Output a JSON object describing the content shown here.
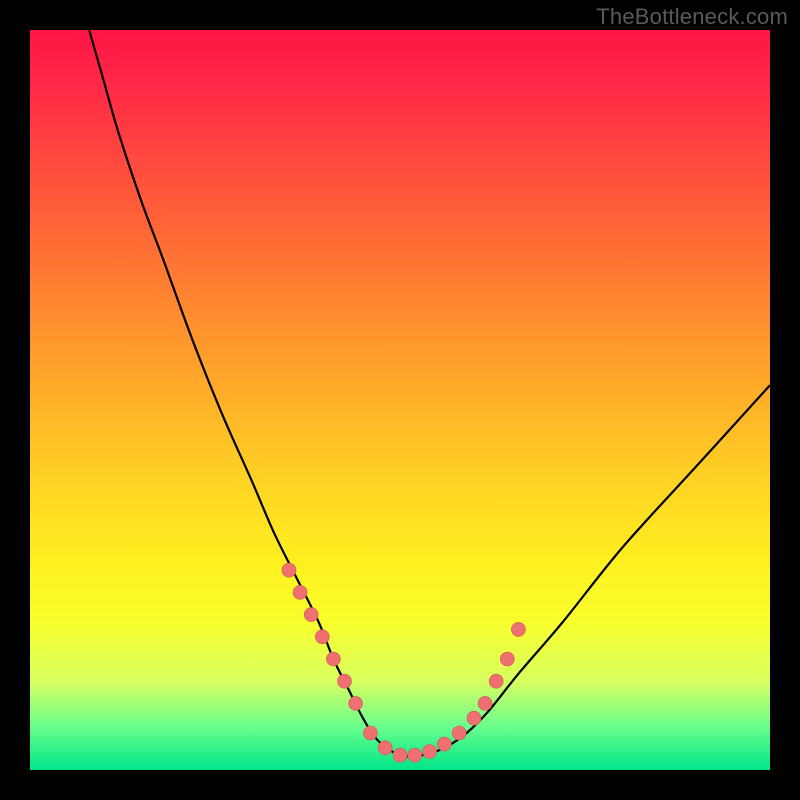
{
  "watermark": "TheBottleneck.com",
  "chart_data": {
    "type": "line",
    "title": "",
    "xlabel": "",
    "ylabel": "",
    "xlim": [
      0,
      100
    ],
    "ylim": [
      0,
      100
    ],
    "series": [
      {
        "name": "bottleneck-curve",
        "x": [
          8,
          10,
          12,
          15,
          18,
          22,
          26,
          30,
          33,
          36,
          39,
          41,
          43,
          45,
          47,
          50,
          53,
          56,
          59,
          62,
          66,
          72,
          80,
          90,
          100
        ],
        "values": [
          100,
          93,
          86,
          77,
          69,
          58,
          48,
          39,
          32,
          26,
          20,
          15,
          11,
          7,
          4,
          2,
          2,
          3,
          5,
          8,
          13,
          20,
          30,
          41,
          52
        ]
      }
    ],
    "markers": {
      "name": "highlight-dots",
      "x": [
        35,
        36.5,
        38,
        39.5,
        41,
        42.5,
        44,
        46,
        48,
        50,
        52,
        54,
        56,
        58,
        60,
        61.5,
        63,
        64.5,
        66
      ],
      "values": [
        27,
        24,
        21,
        18,
        15,
        12,
        9,
        5,
        3,
        2,
        2,
        2.5,
        3.5,
        5,
        7,
        9,
        12,
        15,
        19
      ],
      "color": "#ef7070",
      "radius": 7
    },
    "background_gradient": {
      "top": "#ff1546",
      "upper_mid": "#ffb028",
      "lower_mid": "#fff020",
      "bottom": "#00e58a"
    }
  }
}
